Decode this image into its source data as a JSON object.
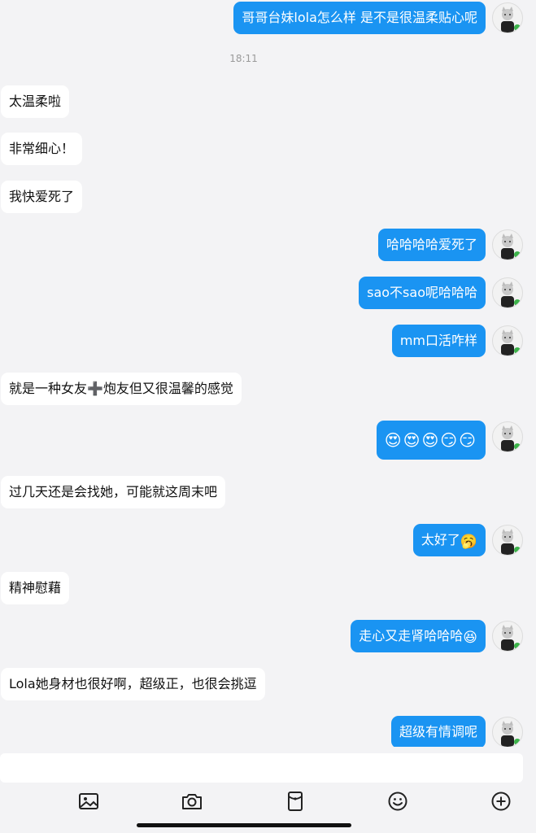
{
  "chat": {
    "time_divider": "18:11",
    "messages": [
      {
        "side": "out",
        "text": "哥哥台妹lola怎么样 是不是很温柔贴心呢"
      },
      {
        "side": "in",
        "text": "太温柔啦"
      },
      {
        "side": "in",
        "text": "非常细心！"
      },
      {
        "side": "in",
        "text": "我快爱死了"
      },
      {
        "side": "out",
        "text": "哈哈哈哈爱死了"
      },
      {
        "side": "out",
        "text": "sao不sao呢哈哈哈"
      },
      {
        "side": "out",
        "text": "mm口活咋样"
      },
      {
        "side": "in",
        "text": "就是一种女友➕炮友但又很温馨的感觉"
      },
      {
        "side": "out",
        "text": "",
        "emoji": "😍😍😍😏😏"
      },
      {
        "side": "in",
        "text": "过几天还是会找她，可能就这周末吧"
      },
      {
        "side": "out",
        "text": "太好了",
        "emoji": "🥱"
      },
      {
        "side": "in",
        "text": "精神慰藉"
      },
      {
        "side": "out",
        "text": "走心又走肾哈哈哈",
        "emoji": "😆"
      },
      {
        "side": "in",
        "text": "Lola她身材也很好啊，超级正，也很会挑逗"
      },
      {
        "side": "out",
        "text": "超级有情调呢"
      }
    ]
  },
  "toolbar": {
    "icons": [
      "image-icon",
      "camera-icon",
      "red-packet-icon",
      "emoji-icon",
      "plus-icon"
    ]
  },
  "colors": {
    "outgoing_bubble": "#1a94f2",
    "incoming_bubble": "#ffffff",
    "background": "#f3f3f5"
  }
}
